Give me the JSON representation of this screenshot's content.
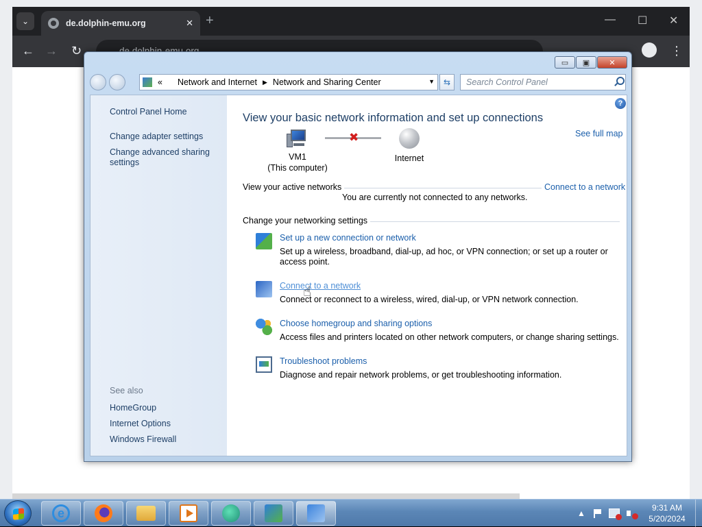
{
  "browser": {
    "tab_title": "de.dolphin-emu.org",
    "tab_close": "✕",
    "new_tab": "+",
    "address": "de.dolphin-emu.org",
    "back": "←",
    "forward": "→",
    "reload": "↻",
    "minimize": "—",
    "maximize": "☐",
    "close": "✕",
    "profile_icon": "account-circle-icon",
    "menu_icon": "⋮"
  },
  "window": {
    "caption": {
      "minimize": "▭",
      "restore": "▣",
      "close": "✕"
    },
    "breadcrumb": {
      "overflow": "«",
      "items": [
        "Network and Internet",
        "Network and Sharing Center"
      ],
      "separator": "▶",
      "dropdown": "▼"
    },
    "refresh": "⇆",
    "search_placeholder": "Search Control Panel"
  },
  "sidebar": {
    "home": "Control Panel Home",
    "links": [
      "Change adapter settings",
      "Change advanced sharing settings"
    ],
    "see_also_label": "See also",
    "see_also": [
      "HomeGroup",
      "Internet Options",
      "Windows Firewall"
    ]
  },
  "main": {
    "help": "?",
    "title": "View your basic network information and set up connections",
    "see_full_map": "See full map",
    "computer_name": "VM1",
    "computer_sub": "(This computer)",
    "internet": "Internet",
    "link_status_icon": "disconnected-x-icon",
    "active_networks_label": "View your active networks",
    "connect_link": "Connect to a network",
    "not_connected": "You are currently not connected to any networks.",
    "settings_label": "Change your networking settings",
    "tasks": [
      {
        "icon": "new-connection-icon",
        "link": "Set up a new connection or network",
        "desc": "Set up a wireless, broadband, dial-up, ad hoc, or VPN connection; or set up a router or access point."
      },
      {
        "icon": "connect-network-icon",
        "link": "Connect to a network",
        "desc": "Connect or reconnect to a wireless, wired, dial-up, or VPN network connection."
      },
      {
        "icon": "homegroup-icon",
        "link": "Choose homegroup and sharing options",
        "desc": "Access files and printers located on other network computers, or change sharing settings."
      },
      {
        "icon": "troubleshoot-icon",
        "link": "Troubleshoot problems",
        "desc": "Diagnose and repair network problems, or get troubleshooting information."
      }
    ]
  },
  "taskbar": {
    "apps": [
      "internet-explorer-icon",
      "firefox-icon",
      "file-explorer-icon",
      "media-player-icon",
      "app-icon",
      "task-manager-icon",
      "control-panel-icon"
    ],
    "ie_glyph": "e",
    "tray_arrow": "▲",
    "time": "9:31 AM",
    "date": "5/20/2024"
  },
  "colors": {
    "link": "#1b5fab",
    "title": "#1e3f66",
    "taskbar": "#5b86b6"
  }
}
